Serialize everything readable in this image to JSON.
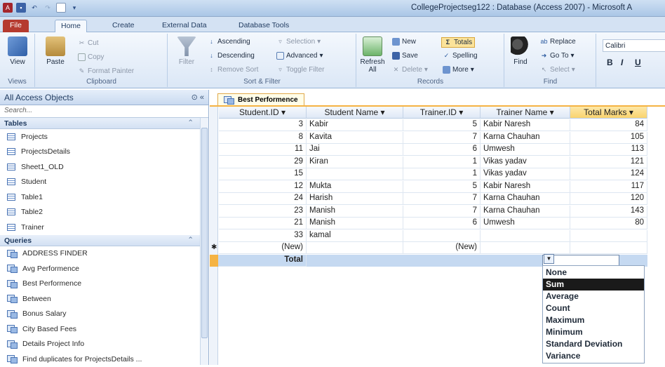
{
  "app": {
    "title": "CollegeProjectseg122 : Database (Access 2007) - Microsoft A"
  },
  "ribbon_tabs": [
    "File",
    "Home",
    "Create",
    "External Data",
    "Database Tools"
  ],
  "ribbon": {
    "views": {
      "view": "View",
      "label": "Views"
    },
    "clipboard": {
      "paste": "Paste",
      "cut": "Cut",
      "copy": "Copy",
      "format_painter": "Format Painter",
      "label": "Clipboard"
    },
    "sort": {
      "filter": "Filter",
      "ascending": "Ascending",
      "descending": "Descending",
      "remove_sort": "Remove Sort",
      "selection": "Selection",
      "advanced": "Advanced",
      "toggle_filter": "Toggle Filter",
      "label": "Sort & Filter"
    },
    "records": {
      "refresh": "Refresh",
      "refresh_sub": "All",
      "new": "New",
      "save": "Save",
      "delete": "Delete",
      "totals": "Totals",
      "spelling": "Spelling",
      "more": "More",
      "label": "Records"
    },
    "find": {
      "find": "Find",
      "replace": "Replace",
      "goto": "Go To",
      "select": "Select",
      "label": "Find"
    },
    "font": {
      "name": "Calibri",
      "bold": "B",
      "italic": "I",
      "underline": "U"
    }
  },
  "nav": {
    "header": "All Access Objects",
    "search_placeholder": "Search...",
    "tables_label": "Tables",
    "tables": [
      "Projects",
      "ProjectsDetails",
      "Sheet1_OLD",
      "Student",
      "Table1",
      "Table2",
      "Trainer"
    ],
    "queries_label": "Queries",
    "queries": [
      "ADDRESS FINDER",
      "Avg Performence",
      "Best Performence",
      "Between",
      "Bonus Salary",
      "City Based Fees",
      "Details Project Info",
      "Find duplicates for ProjectsDetails ..."
    ]
  },
  "document": {
    "tab": "Best Performence"
  },
  "grid": {
    "columns": [
      "Student.ID",
      "Student Name",
      "Trainer.ID",
      "Trainer Name",
      "Total Marks"
    ],
    "rows": [
      [
        "3",
        "Kabir",
        "5",
        "Kabir Naresh",
        "84"
      ],
      [
        "8",
        "Kavita",
        "7",
        "Karna Chauhan",
        "105"
      ],
      [
        "11",
        "Jai",
        "6",
        "Umwesh",
        "113"
      ],
      [
        "29",
        "Kiran",
        "1",
        "Vikas yadav",
        "121"
      ],
      [
        "15",
        "",
        "1",
        "Vikas yadav",
        "124"
      ],
      [
        "12",
        "Mukta",
        "5",
        "Kabir Naresh",
        "117"
      ],
      [
        "24",
        "Harish",
        "7",
        "Karna Chauhan",
        "120"
      ],
      [
        "23",
        "Manish",
        "7",
        "Karna Chauhan",
        "143"
      ],
      [
        "21",
        "Manish",
        "6",
        "Umwesh",
        "80"
      ],
      [
        "33",
        "kamal",
        "",
        "",
        ""
      ]
    ],
    "new_row": [
      "(New)",
      "",
      "(New)",
      "",
      ""
    ],
    "total_label": "Total"
  },
  "totals_dropdown": {
    "options": [
      "None",
      "Sum",
      "Average",
      "Count",
      "Maximum",
      "Minimum",
      "Standard Deviation",
      "Variance"
    ],
    "selected": "Sum"
  },
  "colors": {
    "file_tab": "#b53a2f",
    "doc_tab_accent": "#f5b343",
    "total_row": "#c5d9f1",
    "highlight_header": "#f9d36e"
  }
}
